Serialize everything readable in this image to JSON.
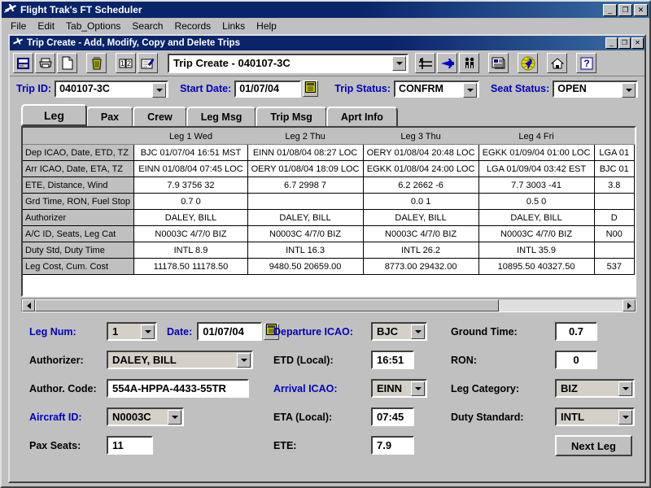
{
  "app": {
    "title": "Flight Trak's FT Scheduler",
    "window_buttons": [
      "minimize",
      "maximize",
      "close"
    ]
  },
  "menubar": {
    "items": [
      "File",
      "Edit",
      "Tab_Options",
      "Search",
      "Records",
      "Links",
      "Help"
    ]
  },
  "child_window": {
    "title": "Trip Create - Add, Modify, Copy and Delete Trips",
    "window_buttons": [
      "minimize",
      "maximize",
      "close"
    ]
  },
  "toolbar": {
    "buttons": [
      {
        "name": "save-icon",
        "label": "Save"
      },
      {
        "name": "print-icon",
        "label": "Print"
      },
      {
        "name": "new-document-icon",
        "label": "New"
      },
      {
        "name": "trash-icon",
        "label": "Delete"
      },
      {
        "name": "numbers-icon",
        "label": "Numbering"
      },
      {
        "name": "edit-pencil-icon",
        "label": "Edit"
      },
      {
        "name": "runway-icon",
        "label": "Runway"
      },
      {
        "name": "airplane-icon",
        "label": "Aircraft"
      },
      {
        "name": "crew-icon",
        "label": "Crew"
      },
      {
        "name": "report-icon",
        "label": "Report"
      },
      {
        "name": "globe-icon",
        "label": "World"
      },
      {
        "name": "home-icon",
        "label": "Home"
      },
      {
        "name": "help-icon",
        "label": "Help"
      }
    ],
    "combo_value": "Trip Create - 040107-3C"
  },
  "header_fields": {
    "trip_id_label": "Trip ID:",
    "trip_id_value": "040107-3C",
    "start_date_label": "Start Date:",
    "start_date_value": "01/07/04",
    "trip_status_label": "Trip Status:",
    "trip_status_value": "CONFRM",
    "seat_status_label": "Seat Status:",
    "seat_status_value": "OPEN"
  },
  "tabs": [
    {
      "label": "Leg",
      "active": true
    },
    {
      "label": "Pax",
      "active": false
    },
    {
      "label": "Crew",
      "active": false
    },
    {
      "label": "Leg Msg",
      "active": false
    },
    {
      "label": "Trip Msg",
      "active": false
    },
    {
      "label": "Aprt Info",
      "active": false
    }
  ],
  "grid": {
    "column_headers": [
      "",
      "Leg 1  Wed",
      "Leg 2  Thu",
      "Leg 3  Thu",
      "Leg 4  Fri",
      ""
    ],
    "row_headers": [
      "Dep ICAO, Date, ETD, TZ",
      "Arr ICAO, Date, ETA, TZ",
      "ETE, Distance, Wind",
      "Grd Time, RON, Fuel Stop",
      "Authorizer",
      "A/C ID, Seats, Leg Cat",
      "Duty Std, Duty Time",
      "Leg Cost, Cum. Cost"
    ],
    "rows": [
      [
        "BJC 01/07/04 16:51 MST",
        "EINN 01/08/04 08:27 LOC",
        "OERY 01/08/04 20:48 LOC",
        "EGKK 01/09/04 01:00 LOC",
        "LGA 01"
      ],
      [
        "EINN 01/08/04 07:45 LOC",
        "OERY 01/08/04 18:09 LOC",
        "EGKK 01/08/04 24:00 LOC",
        "LGA 01/09/04 03:42 EST",
        "BJC 01"
      ],
      [
        "7.9  3756        32",
        "6.7  2998        7",
        "6.2  2662       -6",
        "7.7  3003       -41",
        "3.8"
      ],
      [
        "0.7  0",
        "",
        "0.0  1",
        "0.5  0",
        ""
      ],
      [
        "DALEY, BILL",
        "DALEY, BILL",
        "DALEY, BILL",
        "DALEY, BILL",
        "D"
      ],
      [
        "N0003C  4/7/0 BIZ",
        "N0003C  4/7/0 BIZ",
        "N0003C  4/7/0 BIZ",
        "N0003C  4/7/0 BIZ",
        "N00"
      ],
      [
        "INTL  8.9",
        "INTL  16.3",
        "INTL  26.2",
        "INTL  35.9",
        ""
      ],
      [
        "11178.50  11178.50",
        "9480.50  20659.00",
        "8773.00  29432.00",
        "10895.50  40327.50",
        "537"
      ]
    ]
  },
  "form": {
    "leg_num_label": "Leg Num:",
    "leg_num_value": "1",
    "date_label": "Date:",
    "date_value": "01/07/04",
    "authorizer_label": "Authorizer:",
    "authorizer_value": "DALEY, BILL",
    "author_code_label": "Author. Code:",
    "author_code_value": "554A-HPPA-4433-55TR",
    "aircraft_id_label": "Aircraft ID:",
    "aircraft_id_value": "N0003C",
    "pax_seats_label": "Pax Seats:",
    "pax_seats_value": "11",
    "departure_icao_label": "Departure ICAO:",
    "departure_icao_value": "BJC",
    "etd_label": "ETD (Local):",
    "etd_value": "16:51",
    "arrival_icao_label": "Arrival ICAO:",
    "arrival_icao_value": "EINN",
    "eta_label": "ETA (Local):",
    "eta_value": "07:45",
    "ete_label": "ETE:",
    "ete_value": "7.9",
    "ground_time_label": "Ground Time:",
    "ground_time_value": "0.7",
    "ron_label": "RON:",
    "ron_value": "0",
    "leg_category_label": "Leg Category:",
    "leg_category_value": "BIZ",
    "duty_standard_label": "Duty Standard:",
    "duty_standard_value": "INTL",
    "next_leg_label": "Next Leg"
  },
  "colors": {
    "title_blue": "#0a246a",
    "label_blue": "#0000c0",
    "face": "#c0c0c0",
    "accent_airplane": "#0000cc"
  }
}
